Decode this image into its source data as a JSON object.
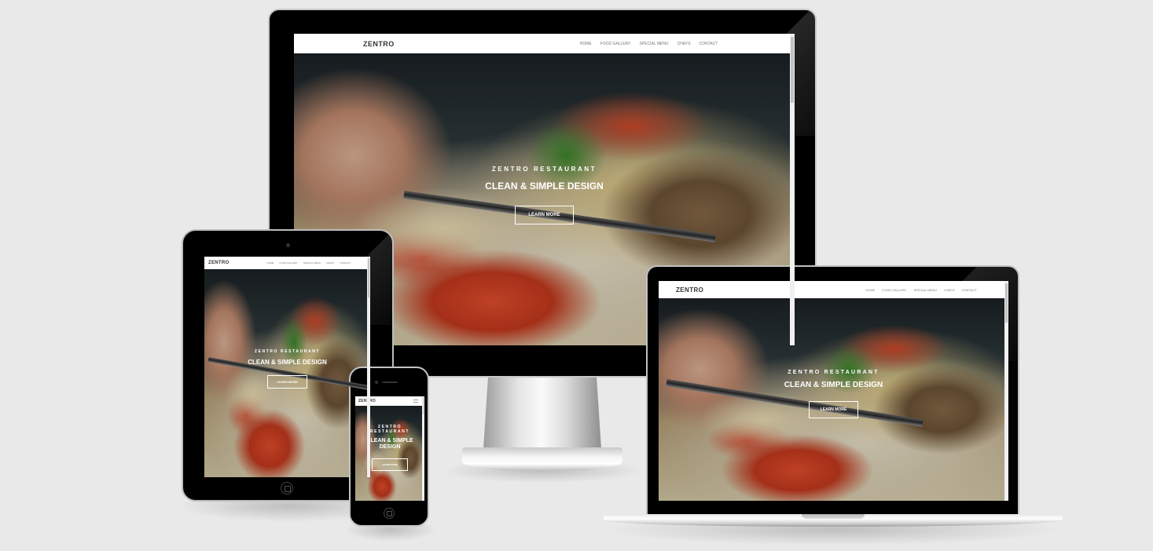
{
  "site": {
    "brand": "ZENTRO",
    "nav": [
      "HOME",
      "FOOD GALLERY",
      "SPECIAL MENU",
      "CHEFS",
      "CONTACT"
    ],
    "hero_kicker": "ZENTRO RESTAURANT",
    "hero_title": "CLEAN & SIMPLE DESIGN",
    "hero_button": "LEARN MORE"
  },
  "phone": {
    "hero_kicker_line1": "ZENTRO",
    "hero_kicker_line2": "RESTAURANT",
    "hero_title_line1": "CLEAN & SIMPLE",
    "hero_title_line2": "DESIGN"
  },
  "colors": {
    "background": "#e9e9e9",
    "device_bezel": "#000000",
    "navbar": "#ffffff",
    "hero_text": "#ffffff"
  }
}
